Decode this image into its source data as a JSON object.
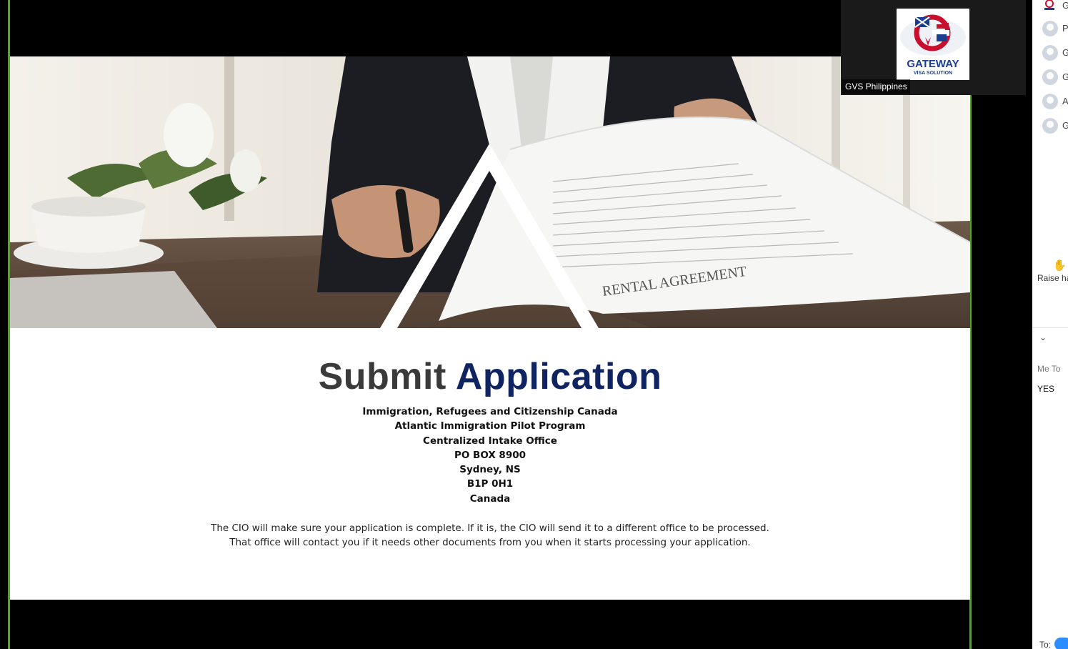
{
  "slide": {
    "title_word1": "Submit",
    "title_word2": "Application",
    "address_lines": [
      "Immigration, Refugees and Citizenship Canada",
      "Atlantic Immigration Pilot Program",
      "Centralized Intake Office",
      "PO BOX 8900",
      "Sydney, NS",
      "B1P 0H1",
      "Canada"
    ],
    "body_lines": [
      "The CIO will make sure your application is complete. If it is, the CIO will send it to a different office to be processed.",
      "That office will contact you if it needs other documents from you when it starts processing your application."
    ],
    "paper_text": "RENTAL AGREEMENT"
  },
  "video_tile": {
    "name": "GVS Philippines",
    "logo_text": "GATEWAY",
    "logo_subtext": "VISA SOLUTION"
  },
  "participants": [
    {
      "initial": "G"
    },
    {
      "initial": "P"
    },
    {
      "initial": "G"
    },
    {
      "initial": "G"
    },
    {
      "initial": "A"
    },
    {
      "initial": "G"
    }
  ],
  "panel": {
    "raise_hand_label": "Raise ha",
    "chat_header": "Me To",
    "last_message": "YES",
    "to_label": "To:"
  },
  "colors": {
    "share_border": "#4caf1a",
    "title_dark": "#3a3a3a",
    "title_blue": "#0f2461",
    "accent_blue": "#2d8cff"
  }
}
